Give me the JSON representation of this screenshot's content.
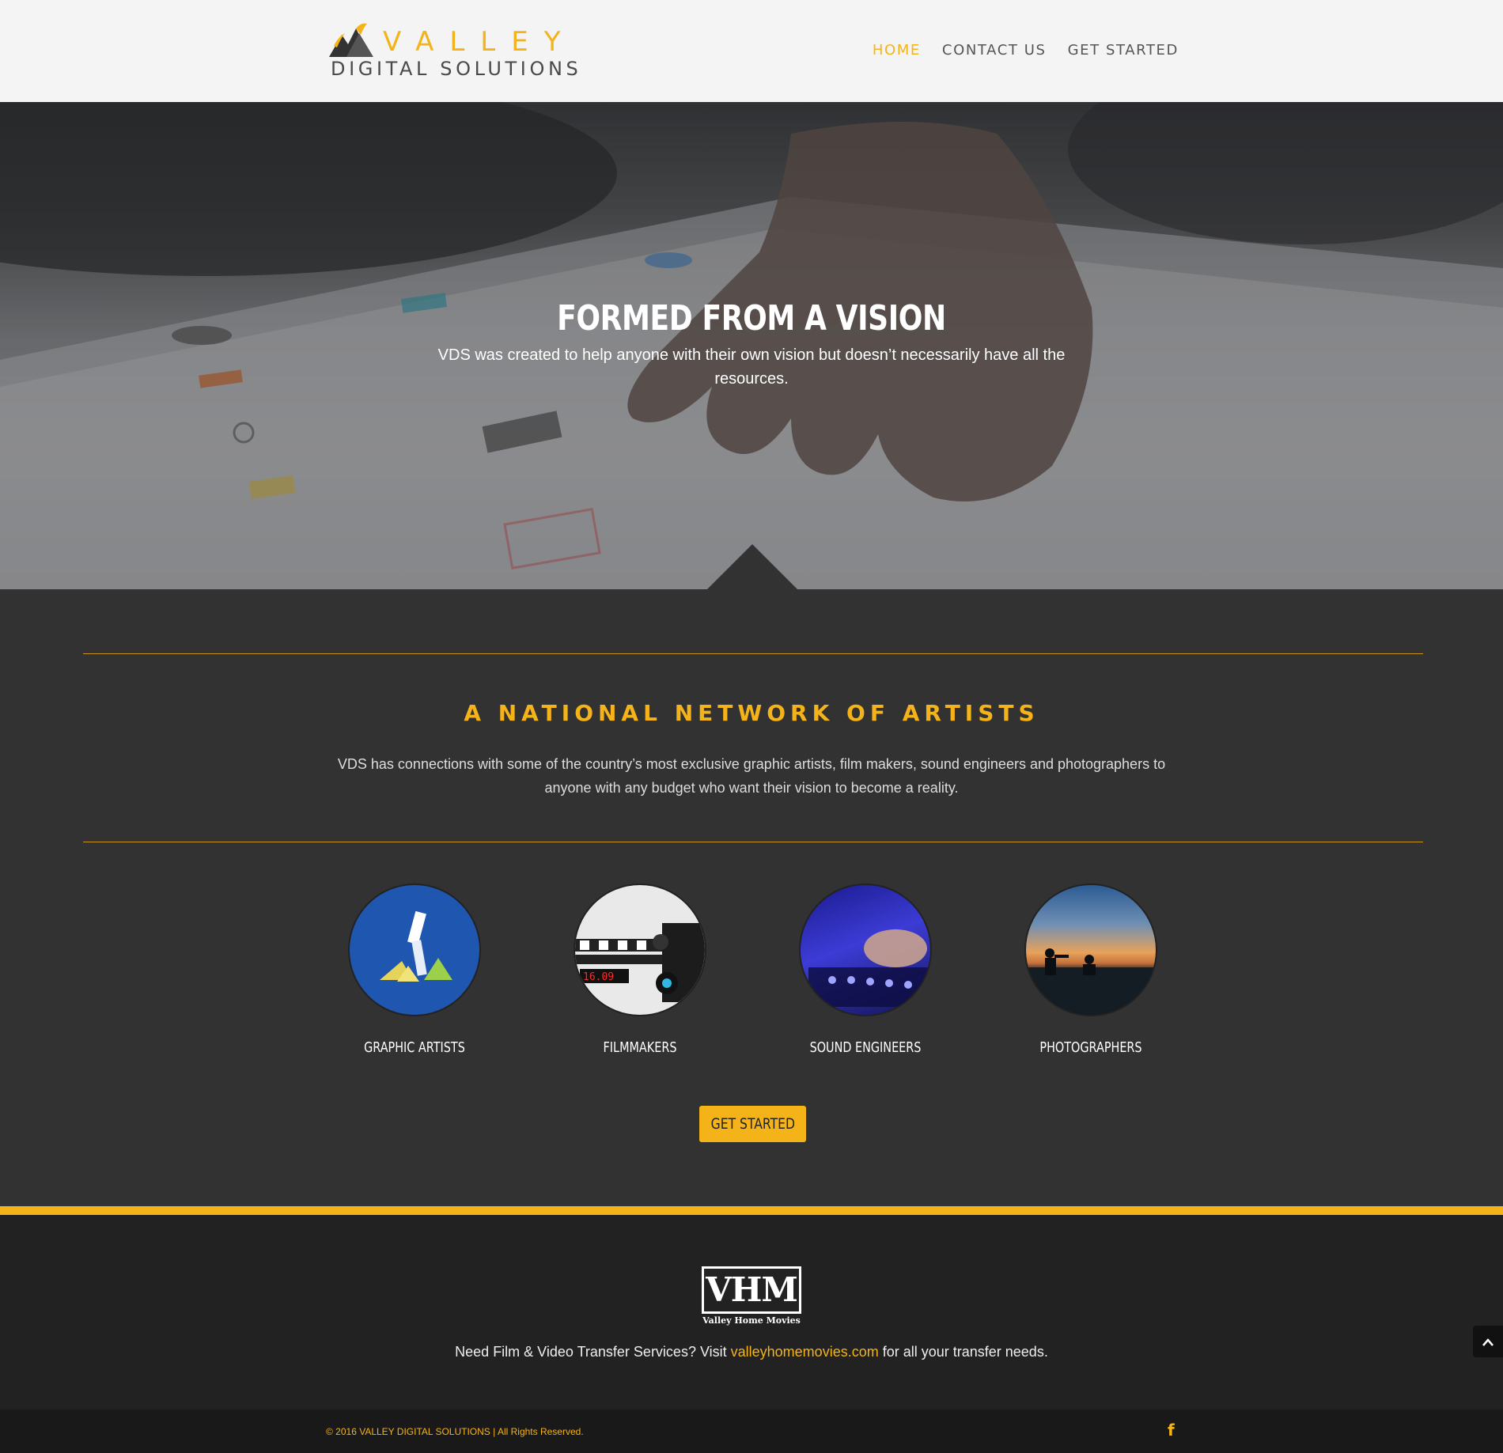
{
  "header": {
    "logo_valley": "VALLEY",
    "logo_digital": "DIGITAL SOLUTIONS",
    "nav": [
      {
        "label": "HOME",
        "active": true
      },
      {
        "label": "CONTACT US",
        "active": false
      },
      {
        "label": "GET STARTED",
        "active": false
      }
    ]
  },
  "hero": {
    "title": "FORMED FROM A VISION",
    "subtitle": "VDS was created to help anyone with their own vision but doesn’t necessarily have all the resources."
  },
  "network": {
    "title": "A NATIONAL NETWORK OF ARTISTS",
    "description": "VDS has connections with some of the country’s most exclusive graphic artists, film makers, sound engineers and photographers to anyone with any budget who want their vision to become a reality.",
    "cards": [
      {
        "label": "GRAPHIC ARTISTS"
      },
      {
        "label": "FILMMAKERS",
        "clapper_text": "16.09"
      },
      {
        "label": "SOUND ENGINEERS"
      },
      {
        "label": "PHOTOGRAPHERS"
      }
    ],
    "cta_label": "GET STARTED"
  },
  "footer": {
    "vhm_logo_text": "VHM",
    "vhm_tagline": "Valley Home Movies",
    "text_before": "Need Film & Video Transfer Services? Visit ",
    "link_text": "valleyhomemovies.com",
    "text_after": " for all your transfer needs.",
    "copyright": "© 2016 VALLEY DIGITAL SOLUTIONS | All Rights Reserved.",
    "facebook_icon": "f"
  },
  "colors": {
    "accent": "#f5b31a",
    "section_bg": "#323232",
    "footer_bg": "#222222",
    "bottom_bar_bg": "#191919"
  }
}
